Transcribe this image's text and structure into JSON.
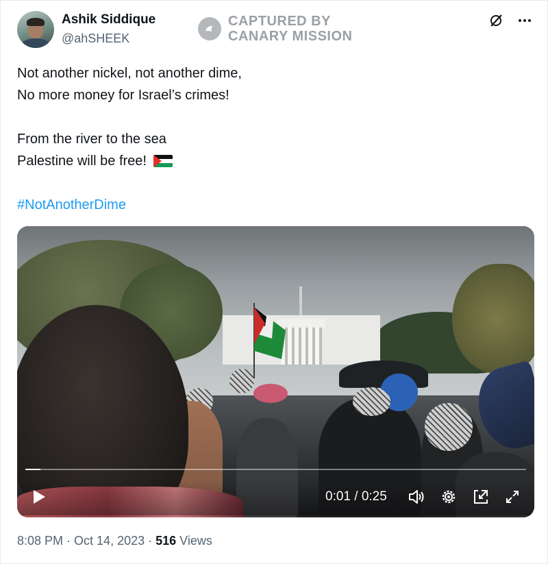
{
  "author": {
    "display_name": "Ashik Siddique",
    "handle": "@ahSHEEK"
  },
  "watermark": {
    "line1": "CAPTURED BY",
    "line2": "CANARY MISSION"
  },
  "tweet": {
    "lines": [
      "Not another nickel, not another dime,",
      "No more money for Israel’s crimes!",
      "",
      "From the river to the sea",
      "Palestine will be free!"
    ],
    "hashtag": "#NotAnotherDime"
  },
  "video": {
    "progress_fraction": 0.03,
    "current_time": "0:01",
    "separator": " / ",
    "duration": "0:25"
  },
  "meta": {
    "time": "8:08 PM",
    "dot1": " · ",
    "date": "Oct 14, 2023",
    "dot2": " · ",
    "views_count": "516",
    "views_label": " Views"
  },
  "icons": {
    "grok": "grok-icon",
    "more": "more-icon",
    "flag": "palestine-flag-emoji",
    "play": "play-icon",
    "volume": "volume-icon",
    "settings": "settings-gear-icon",
    "pip": "picture-in-picture-icon",
    "fullscreen": "fullscreen-icon"
  },
  "colors": {
    "link": "#1d9bf0",
    "secondary_text": "#536471",
    "primary_text": "#0f1419"
  }
}
